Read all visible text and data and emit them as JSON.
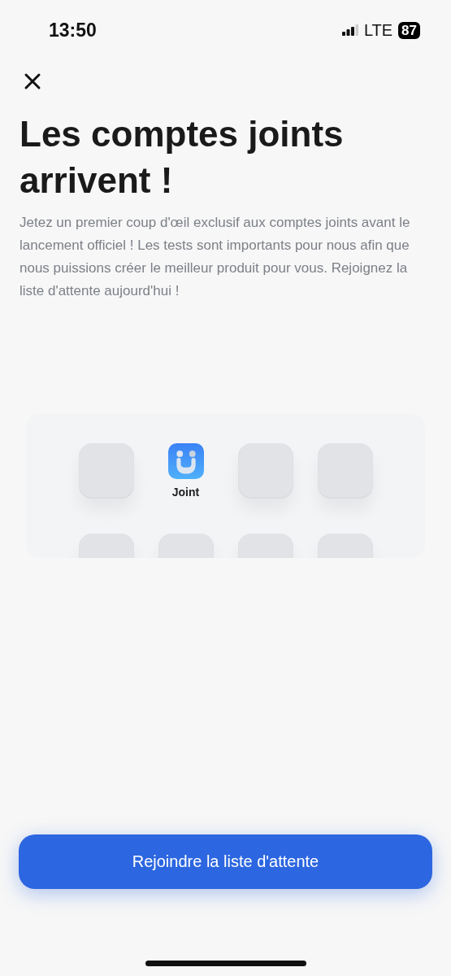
{
  "status_bar": {
    "time": "13:50",
    "network": "LTE",
    "battery": "87"
  },
  "title": "Les comptes joints arrivent !",
  "description": "Jetez un premier coup d'œil exclusif aux comptes joints avant le lancement officiel ! Les tests sont importants pour nous afin que nous puissions créer le meilleur produit pour vous. Rejoignez la liste d'attente aujourd'hui !",
  "tiles": [
    {
      "kind": "blank"
    },
    {
      "kind": "app",
      "label": "Joint"
    },
    {
      "kind": "blank"
    },
    {
      "kind": "blank"
    },
    {
      "kind": "blank"
    },
    {
      "kind": "blank"
    },
    {
      "kind": "blank"
    },
    {
      "kind": "blank"
    }
  ],
  "button": "Rejoindre la liste d'attente"
}
